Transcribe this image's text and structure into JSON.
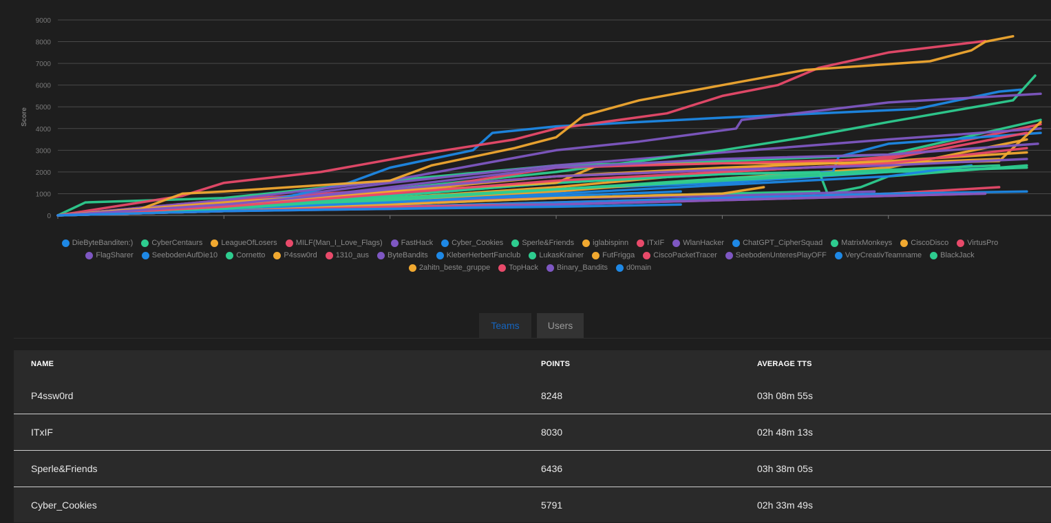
{
  "chart_data": {
    "type": "line",
    "ylabel": "Score",
    "ylim": [
      0,
      9000
    ],
    "yticks": [
      "0",
      "1000",
      "2000",
      "3000",
      "4000",
      "5000",
      "6000",
      "7000",
      "8000",
      "9000"
    ],
    "xlim": [
      "07:00",
      "12:55"
    ],
    "xticks": [
      "07:00",
      "08:00",
      "09:00",
      "10:00",
      "11:00",
      "12:00"
    ],
    "grid": true,
    "legend_position": "bottom",
    "series": [
      {
        "name": "DieByteBanditen:)",
        "color": "#1e88e5",
        "points": [
          [
            "07:00",
            0
          ],
          [
            "09:00",
            700
          ],
          [
            "10:00",
            1200
          ],
          [
            "11:00",
            1500
          ],
          [
            "12:00",
            2000
          ],
          [
            "12:45",
            2200
          ]
        ]
      },
      {
        "name": "CyberCentaurs",
        "color": "#2ecc8f",
        "points": [
          [
            "07:00",
            0
          ],
          [
            "07:10",
            600
          ],
          [
            "08:00",
            800
          ],
          [
            "09:00",
            1600
          ],
          [
            "10:00",
            2300
          ],
          [
            "11:00",
            2500
          ],
          [
            "12:00",
            2800
          ],
          [
            "12:55",
            4400
          ]
        ]
      },
      {
        "name": "LeagueOfLosers",
        "color": "#f0a830",
        "points": [
          [
            "07:00",
            0
          ],
          [
            "08:00",
            300
          ],
          [
            "09:00",
            700
          ],
          [
            "10:00",
            1100
          ],
          [
            "11:00",
            1700
          ],
          [
            "12:00",
            2200
          ],
          [
            "12:50",
            3500
          ]
        ]
      },
      {
        "name": "MILF(Man_I_Love_Flags)",
        "color": "#e84a6a",
        "points": [
          [
            "07:00",
            0
          ],
          [
            "08:00",
            700
          ],
          [
            "09:00",
            1200
          ],
          [
            "10:00",
            1800
          ],
          [
            "11:00",
            2100
          ],
          [
            "12:00",
            2700
          ],
          [
            "12:55",
            4200
          ]
        ]
      },
      {
        "name": "FastHack",
        "color": "#7e57c2",
        "points": [
          [
            "07:00",
            0
          ],
          [
            "08:00",
            500
          ],
          [
            "09:00",
            1500
          ],
          [
            "10:00",
            2300
          ],
          [
            "11:00",
            2900
          ],
          [
            "12:00",
            3500
          ],
          [
            "12:55",
            4000
          ]
        ]
      },
      {
        "name": "Cyber_Cookies",
        "color": "#1e88e5",
        "points": [
          [
            "07:00",
            0
          ],
          [
            "08:00",
            200
          ],
          [
            "08:45",
            1500
          ],
          [
            "09:00",
            2200
          ],
          [
            "09:30",
            3000
          ],
          [
            "09:37",
            3800
          ],
          [
            "10:00",
            4100
          ],
          [
            "11:00",
            4500
          ],
          [
            "12:10",
            4900
          ],
          [
            "12:40",
            5700
          ],
          [
            "12:48",
            5791
          ]
        ]
      },
      {
        "name": "Sperle&Friends",
        "color": "#2ecc8f",
        "points": [
          [
            "07:00",
            0
          ],
          [
            "08:00",
            400
          ],
          [
            "09:00",
            1200
          ],
          [
            "10:00",
            2000
          ],
          [
            "11:00",
            3000
          ],
          [
            "11:30",
            3600
          ],
          [
            "12:00",
            4300
          ],
          [
            "12:45",
            5300
          ],
          [
            "12:53",
            6436
          ]
        ]
      },
      {
        "name": "iglabispinn",
        "color": "#f0a830",
        "points": [
          [
            "07:00",
            0
          ],
          [
            "08:00",
            300
          ],
          [
            "09:00",
            800
          ],
          [
            "10:00",
            1300
          ],
          [
            "11:00",
            2000
          ],
          [
            "12:00",
            2400
          ],
          [
            "12:40",
            2600
          ]
        ]
      },
      {
        "name": "ITxIF",
        "color": "#e84a6a",
        "points": [
          [
            "07:00",
            0
          ],
          [
            "07:45",
            900
          ],
          [
            "08:00",
            1500
          ],
          [
            "08:35",
            2000
          ],
          [
            "09:10",
            2800
          ],
          [
            "09:45",
            3500
          ],
          [
            "10:00",
            4000
          ],
          [
            "10:40",
            4700
          ],
          [
            "11:00",
            5500
          ],
          [
            "11:20",
            6000
          ],
          [
            "11:35",
            6800
          ],
          [
            "12:00",
            7500
          ],
          [
            "12:35",
            8030
          ]
        ]
      },
      {
        "name": "WlanHacker",
        "color": "#7e57c2",
        "points": [
          [
            "07:00",
            0
          ],
          [
            "08:00",
            700
          ],
          [
            "09:00",
            1600
          ],
          [
            "10:00",
            3000
          ],
          [
            "10:30",
            3400
          ],
          [
            "11:05",
            4000
          ],
          [
            "11:07",
            4400
          ],
          [
            "12:00",
            5200
          ],
          [
            "12:55",
            5600
          ]
        ]
      },
      {
        "name": "ChatGPT_CipherSquad",
        "color": "#1e88e5",
        "points": [
          [
            "07:00",
            0
          ],
          [
            "08:00",
            300
          ],
          [
            "09:00",
            900
          ],
          [
            "10:00",
            1500
          ],
          [
            "11:00",
            1900
          ],
          [
            "11:40",
            2000
          ],
          [
            "11:42",
            2700
          ],
          [
            "12:00",
            3300
          ],
          [
            "12:55",
            3800
          ]
        ]
      },
      {
        "name": "MatrixMonkeys",
        "color": "#2ecc8f",
        "points": [
          [
            "07:00",
            0
          ],
          [
            "08:00",
            400
          ],
          [
            "09:00",
            900
          ],
          [
            "10:00",
            1500
          ],
          [
            "11:00",
            1900
          ],
          [
            "11:35",
            2000
          ],
          [
            "11:38",
            1000
          ],
          [
            "11:50",
            1300
          ],
          [
            "12:00",
            1800
          ],
          [
            "12:50",
            2300
          ]
        ]
      },
      {
        "name": "CiscoDisco",
        "color": "#f0a830",
        "points": [
          [
            "07:00",
            0
          ],
          [
            "08:00",
            600
          ],
          [
            "09:00",
            1100
          ],
          [
            "10:00",
            1500
          ],
          [
            "10:15",
            2300
          ],
          [
            "11:00",
            2400
          ],
          [
            "12:00",
            2400
          ],
          [
            "12:40",
            2500
          ],
          [
            "12:55",
            4300
          ]
        ]
      },
      {
        "name": "VirtusPro",
        "color": "#e84a6a",
        "points": [
          [
            "07:00",
            0
          ],
          [
            "08:00",
            500
          ],
          [
            "09:00",
            1000
          ],
          [
            "10:00",
            2200
          ],
          [
            "11:00",
            2400
          ],
          [
            "12:00",
            2600
          ],
          [
            "12:50",
            3800
          ]
        ]
      },
      {
        "name": "FlagSharer",
        "color": "#7e57c2",
        "points": [
          [
            "07:00",
            0
          ],
          [
            "08:00",
            400
          ],
          [
            "09:00",
            1300
          ],
          [
            "10:00",
            2200
          ],
          [
            "11:00",
            2600
          ],
          [
            "12:00",
            2800
          ],
          [
            "12:54",
            3300
          ]
        ]
      },
      {
        "name": "SeebodenAufDie10",
        "color": "#1e88e5",
        "points": [
          [
            "07:00",
            0
          ],
          [
            "08:00",
            300
          ],
          [
            "09:00",
            600
          ],
          [
            "10:00",
            900
          ],
          [
            "10:45",
            1100
          ]
        ]
      },
      {
        "name": "Cornetto",
        "color": "#2ecc8f",
        "points": [
          [
            "07:00",
            0
          ],
          [
            "08:00",
            200
          ],
          [
            "09:00",
            500
          ],
          [
            "10:00",
            800
          ],
          [
            "11:00",
            1000
          ],
          [
            "11:35",
            1100
          ]
        ]
      },
      {
        "name": "P4ssw0rd",
        "color": "#f0a830",
        "points": [
          [
            "07:00",
            0
          ],
          [
            "07:30",
            300
          ],
          [
            "07:45",
            1000
          ],
          [
            "08:00",
            1100
          ],
          [
            "09:00",
            1600
          ],
          [
            "09:15",
            2300
          ],
          [
            "09:45",
            3100
          ],
          [
            "10:00",
            3600
          ],
          [
            "10:10",
            4600
          ],
          [
            "10:30",
            5300
          ],
          [
            "11:00",
            6000
          ],
          [
            "11:30",
            6700
          ],
          [
            "12:15",
            7100
          ],
          [
            "12:30",
            7600
          ],
          [
            "12:35",
            8000
          ],
          [
            "12:45",
            8248
          ]
        ]
      },
      {
        "name": "1310_aus",
        "color": "#e84a6a",
        "points": [
          [
            "07:00",
            0
          ],
          [
            "08:00",
            200
          ],
          [
            "09:00",
            400
          ],
          [
            "10:00",
            600
          ],
          [
            "11:00",
            800
          ],
          [
            "12:00",
            1000
          ],
          [
            "12:40",
            1300
          ]
        ]
      },
      {
        "name": "ByteBandits",
        "color": "#7e57c2",
        "points": [
          [
            "07:00",
            0
          ],
          [
            "08:00",
            300
          ],
          [
            "09:00",
            600
          ],
          [
            "10:00",
            800
          ],
          [
            "11:00",
            900
          ],
          [
            "11:55",
            1100
          ]
        ]
      },
      {
        "name": "KleberHerbertFanclub",
        "color": "#1e88e5",
        "points": [
          [
            "07:00",
            0
          ],
          [
            "08:00",
            200
          ],
          [
            "09:00",
            400
          ],
          [
            "10:00",
            600
          ],
          [
            "11:00",
            800
          ],
          [
            "12:00",
            1000
          ],
          [
            "12:50",
            1100
          ]
        ]
      },
      {
        "name": "LukasKrainer",
        "color": "#2ecc8f",
        "points": [
          [
            "07:00",
            0
          ],
          [
            "08:00",
            300
          ],
          [
            "09:00",
            700
          ],
          [
            "10:00",
            1200
          ],
          [
            "11:00",
            1600
          ],
          [
            "12:00",
            2000
          ],
          [
            "12:50",
            2200
          ]
        ]
      },
      {
        "name": "FutFrigga",
        "color": "#f0a830",
        "points": [
          [
            "07:00",
            0
          ],
          [
            "08:00",
            200
          ],
          [
            "09:00",
            500
          ],
          [
            "10:00",
            800
          ],
          [
            "11:00",
            1000
          ],
          [
            "11:15",
            1300
          ]
        ]
      },
      {
        "name": "CiscoPacketTracer",
        "color": "#e84a6a",
        "points": [
          [
            "07:00",
            0
          ],
          [
            "08:00",
            200
          ],
          [
            "09:00",
            400
          ],
          [
            "10:00",
            500
          ],
          [
            "11:00",
            700
          ],
          [
            "12:00",
            900
          ],
          [
            "12:35",
            1000
          ]
        ]
      },
      {
        "name": "SeebodenUnteresPlayOFF",
        "color": "#7e57c2",
        "points": [
          [
            "07:00",
            0
          ],
          [
            "08:00",
            200
          ],
          [
            "09:00",
            300
          ],
          [
            "10:00",
            500
          ],
          [
            "11:00",
            700
          ],
          [
            "12:00",
            900
          ],
          [
            "12:35",
            1000
          ]
        ]
      },
      {
        "name": "VeryCreativTeamname",
        "color": "#1e88e5",
        "points": [
          [
            "07:00",
            0
          ],
          [
            "08:00",
            300
          ],
          [
            "09:00",
            600
          ],
          [
            "10:00",
            1000
          ],
          [
            "11:00",
            1400
          ],
          [
            "12:00",
            1800
          ],
          [
            "12:30",
            2300
          ]
        ]
      },
      {
        "name": "BlackJack",
        "color": "#2ecc8f",
        "points": [
          [
            "07:00",
            0
          ],
          [
            "08:00",
            300
          ],
          [
            "09:00",
            800
          ],
          [
            "10:00",
            1200
          ],
          [
            "11:00",
            1700
          ],
          [
            "12:00",
            2100
          ],
          [
            "12:40",
            2300
          ]
        ]
      },
      {
        "name": "2ahitn_beste_gruppe",
        "color": "#f0a830",
        "points": [
          [
            "07:00",
            0
          ],
          [
            "08:00",
            400
          ],
          [
            "09:00",
            1100
          ],
          [
            "10:00",
            1800
          ],
          [
            "11:00",
            2200
          ],
          [
            "12:00",
            2500
          ],
          [
            "12:50",
            2900
          ]
        ]
      },
      {
        "name": "TopHack",
        "color": "#e84a6a",
        "points": [
          [
            "07:00",
            0
          ],
          [
            "08:00",
            400
          ],
          [
            "09:00",
            1000
          ],
          [
            "10:00",
            1600
          ],
          [
            "11:00",
            2000
          ],
          [
            "12:00",
            2400
          ],
          [
            "12:50",
            3100
          ]
        ]
      },
      {
        "name": "Binary_Bandits",
        "color": "#7e57c2",
        "points": [
          [
            "07:00",
            0
          ],
          [
            "08:00",
            500
          ],
          [
            "09:00",
            1200
          ],
          [
            "10:00",
            1800
          ],
          [
            "11:00",
            2100
          ],
          [
            "12:00",
            2300
          ],
          [
            "12:50",
            2600
          ]
        ]
      },
      {
        "name": "d0main",
        "color": "#1e88e5",
        "points": [
          [
            "07:00",
            0
          ],
          [
            "08:00",
            200
          ],
          [
            "09:00",
            300
          ],
          [
            "10:00",
            400
          ],
          [
            "10:45",
            500
          ]
        ]
      }
    ]
  },
  "tabs": {
    "teams": "Teams",
    "users": "Users"
  },
  "table": {
    "headers": {
      "name": "NAME",
      "points": "POINTS",
      "tts": "AVERAGE TTS"
    },
    "rows": [
      {
        "name": "P4ssw0rd",
        "points": "8248",
        "tts": "03h 08m 55s"
      },
      {
        "name": "ITxIF",
        "points": "8030",
        "tts": "02h 48m 13s"
      },
      {
        "name": "Sperle&Friends",
        "points": "6436",
        "tts": "03h 38m 05s"
      },
      {
        "name": "Cyber_Cookies",
        "points": "5791",
        "tts": "02h 33m 49s"
      }
    ]
  }
}
